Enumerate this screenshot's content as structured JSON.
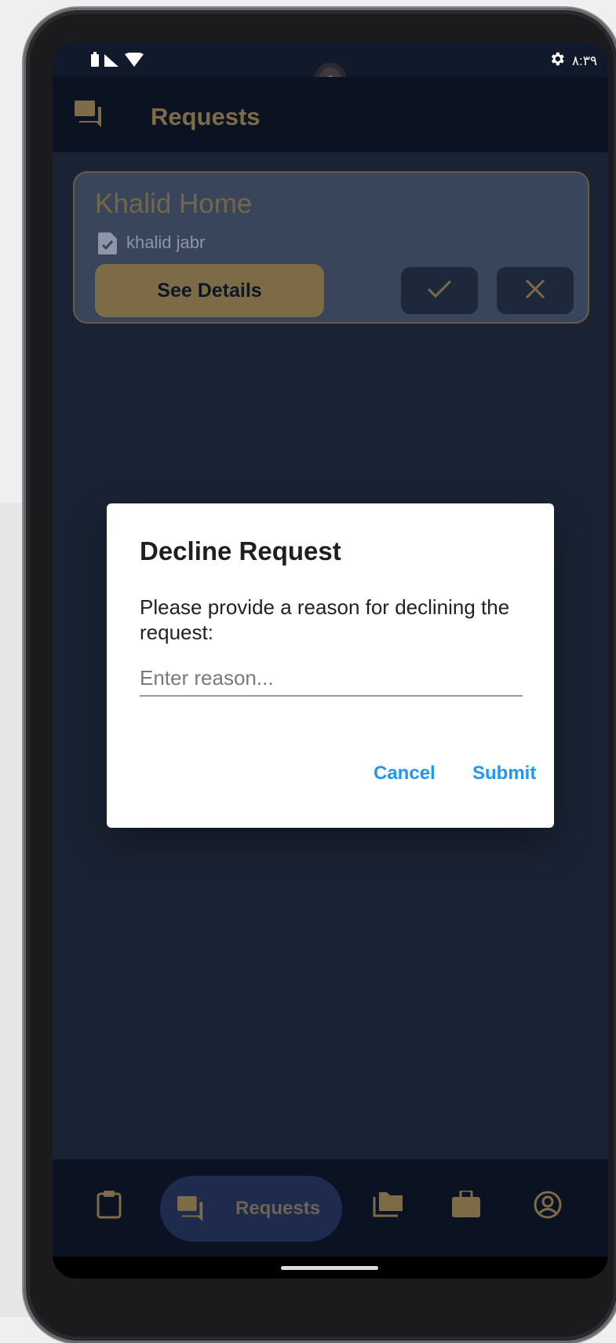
{
  "status_bar": {
    "time": "٨:٣٩",
    "icons": [
      "battery-icon",
      "signal-icon",
      "wifi-icon",
      "settings-icon"
    ]
  },
  "app_bar": {
    "title": "Requests",
    "icon": "chat-icon"
  },
  "request_card": {
    "title": "Khalid Home",
    "user": "khalid jabr",
    "details_label": "See Details",
    "accept_icon": "check-icon",
    "decline_icon": "close-icon"
  },
  "dialog": {
    "title": "Decline Request",
    "message": "Please provide a reason for declining the request:",
    "placeholder": "Enter reason...",
    "value": "",
    "cancel_label": "Cancel",
    "submit_label": "Submit"
  },
  "bottom_nav": {
    "items": [
      {
        "icon": "clipboard-icon",
        "label": ""
      },
      {
        "icon": "chat-icon",
        "label": "Requests",
        "active": true
      },
      {
        "icon": "folders-icon",
        "label": ""
      },
      {
        "icon": "briefcase-icon",
        "label": ""
      },
      {
        "icon": "account-icon",
        "label": ""
      }
    ]
  },
  "colors": {
    "accent": "#7d6b48",
    "background": "#1a2334",
    "link": "#2196f3"
  }
}
